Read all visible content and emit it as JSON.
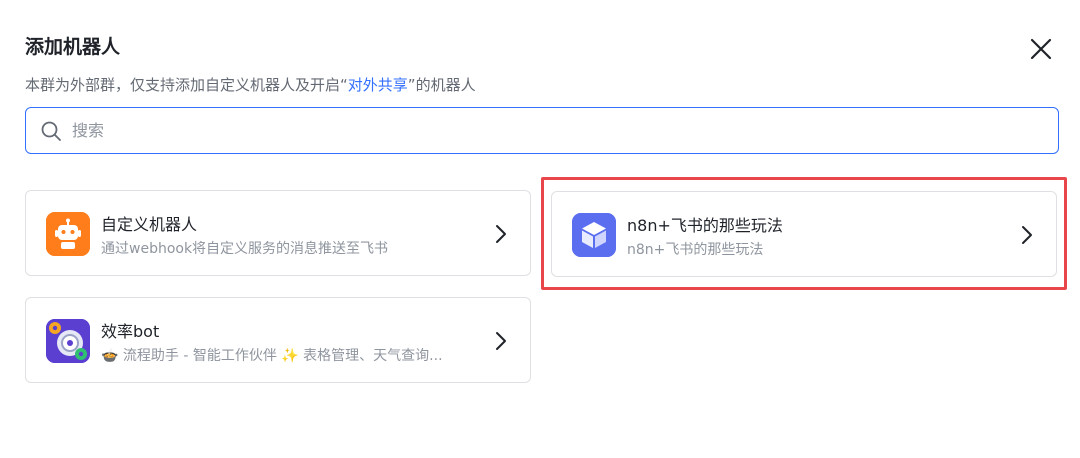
{
  "dialog": {
    "title": "添加机器人",
    "subtitle_prefix": "本群为外部群，仅支持添加自定义机器人及开启“",
    "subtitle_link": "对外共享",
    "subtitle_suffix": "”的机器人"
  },
  "search": {
    "placeholder": "搜索",
    "value": ""
  },
  "bots": [
    {
      "name": "自定义机器人",
      "description": "通过webhook将自定义服务的消息推送至飞书",
      "icon": "robot-icon",
      "color": "#ff7d1a"
    },
    {
      "name": "n8n+飞书的那些玩法",
      "description": "n8n+飞书的那些玩法",
      "icon": "cube-icon",
      "color": "#5b6ef0"
    },
    {
      "name": "效率bot",
      "description": "🍲 流程助手 - 智能工作伙伴 ✨ 表格管理、天气查询...",
      "icon": "gear-cluster-icon",
      "color": "#5a3fd1"
    }
  ],
  "colors": {
    "accent": "#3370ff",
    "highlight": "#e8464a",
    "border": "#dee0e3"
  }
}
